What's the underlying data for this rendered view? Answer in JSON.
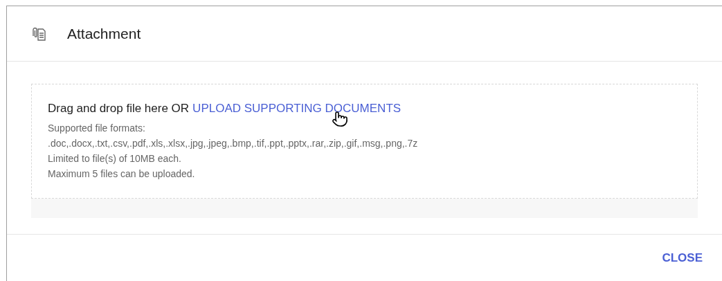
{
  "dialog": {
    "title": "Attachment"
  },
  "dropzone": {
    "prompt": "Drag and drop file here OR",
    "link": "UPLOAD SUPPORTING DOCUMENTS",
    "notes": [
      "Supported file formats:",
      ".doc,.docx,.txt,.csv,.pdf,.xls,.xlsx,.jpg,.jpeg,.bmp,.tif,.ppt,.pptx,.rar,.zip,.gif,.msg,.png,.7z",
      "Limited to file(s) of 10MB each.",
      "Maximum 5 files can be uploaded."
    ]
  },
  "buttons": [
    "CLOSE"
  ]
}
